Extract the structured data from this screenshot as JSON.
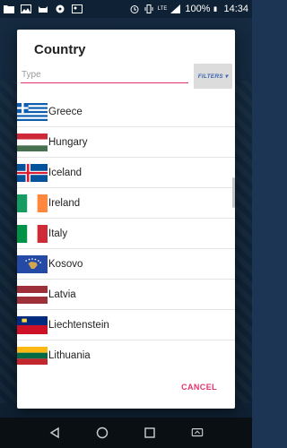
{
  "status_bar": {
    "battery": "100%",
    "time": "14:34",
    "network": "LTE"
  },
  "dialog": {
    "title": "Country",
    "search_placeholder": "Type",
    "filters_label": "FILTERS ▾",
    "cancel_label": "CANCEL",
    "countries": [
      {
        "name": "Greece",
        "flag": "greece-flag-icon"
      },
      {
        "name": "Hungary",
        "flag": "hungary-flag-icon"
      },
      {
        "name": "Iceland",
        "flag": "iceland-flag-icon"
      },
      {
        "name": "Ireland",
        "flag": "ireland-flag-icon"
      },
      {
        "name": "Italy",
        "flag": "italy-flag-icon"
      },
      {
        "name": "Kosovo",
        "flag": "kosovo-flag-icon"
      },
      {
        "name": "Latvia",
        "flag": "latvia-flag-icon"
      },
      {
        "name": "Liechtenstein",
        "flag": "liechtenstein-flag-icon"
      },
      {
        "name": "Lithuania",
        "flag": "lithuania-flag-icon"
      }
    ]
  },
  "colors": {
    "accent": "#e0336e",
    "filters_text": "#3e67b3"
  }
}
